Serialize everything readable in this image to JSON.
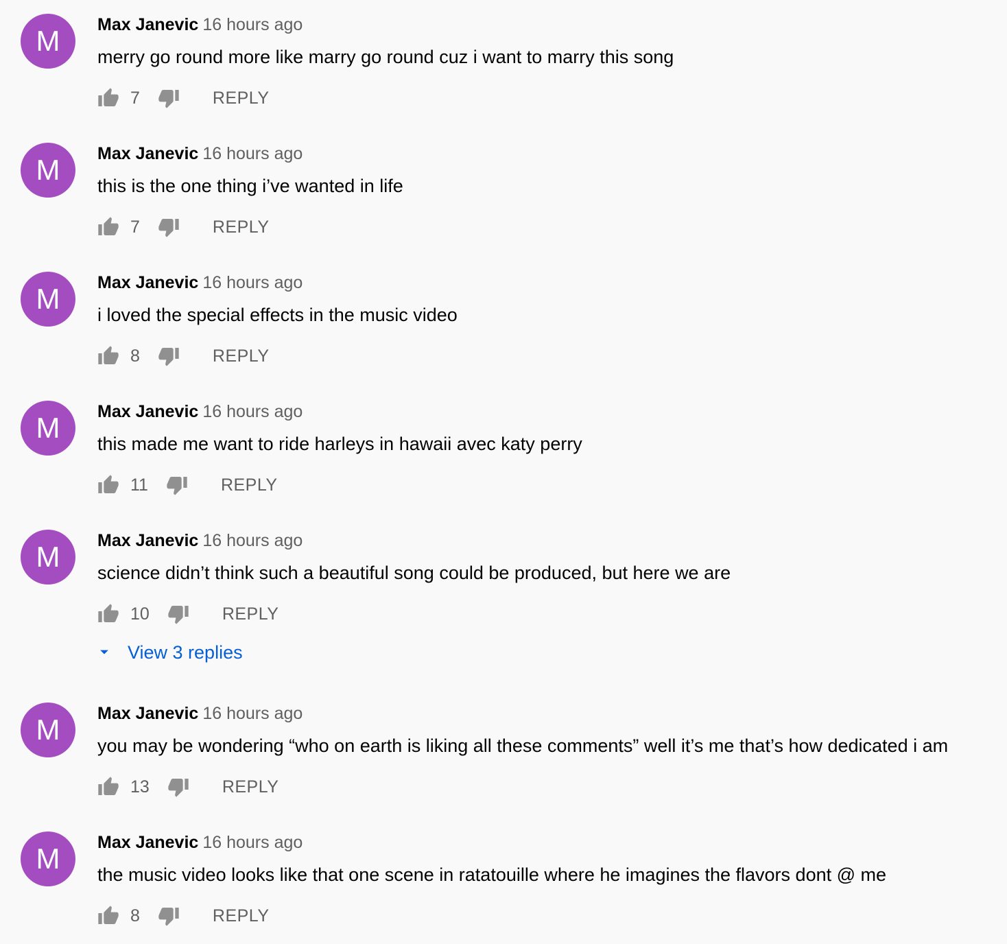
{
  "colors": {
    "avatar_bg": "#a44dc1",
    "link": "#065fd4",
    "muted": "#606060",
    "icon": "#909090"
  },
  "icons": {
    "like": "thumb-up-icon",
    "dislike": "thumb-down-icon",
    "expand": "caret-down-icon"
  },
  "comments": [
    {
      "avatar_letter": "M",
      "author": "Max Janevic",
      "time": "16 hours ago",
      "text": "merry go round more like marry go round cuz i want to marry this song",
      "likes": "7",
      "reply_label": "REPLY"
    },
    {
      "avatar_letter": "M",
      "author": "Max Janevic",
      "time": "16 hours ago",
      "text": "this is the one thing i’ve wanted in life",
      "likes": "7",
      "reply_label": "REPLY"
    },
    {
      "avatar_letter": "M",
      "author": "Max Janevic",
      "time": "16 hours ago",
      "text": "i loved the special effects in the music video",
      "likes": "8",
      "reply_label": "REPLY"
    },
    {
      "avatar_letter": "M",
      "author": "Max Janevic",
      "time": "16 hours ago",
      "text": "this made me want to ride harleys in hawaii avec katy perry",
      "likes": "11",
      "reply_label": "REPLY"
    },
    {
      "avatar_letter": "M",
      "author": "Max Janevic",
      "time": "16 hours ago",
      "text": "science didn’t think such a beautiful song could be produced, but here we are",
      "likes": "10",
      "reply_label": "REPLY",
      "view_replies": "View 3 replies"
    },
    {
      "avatar_letter": "M",
      "author": "Max Janevic",
      "time": "16 hours ago",
      "text": "you may be wondering “who on earth is liking all these comments” well it’s me that’s how dedicated i am",
      "likes": "13",
      "reply_label": "REPLY"
    },
    {
      "avatar_letter": "M",
      "author": "Max Janevic",
      "time": "16 hours ago",
      "text": "the music video looks like that one scene in ratatouille where he imagines the flavors dont @ me",
      "likes": "8",
      "reply_label": "REPLY"
    }
  ]
}
